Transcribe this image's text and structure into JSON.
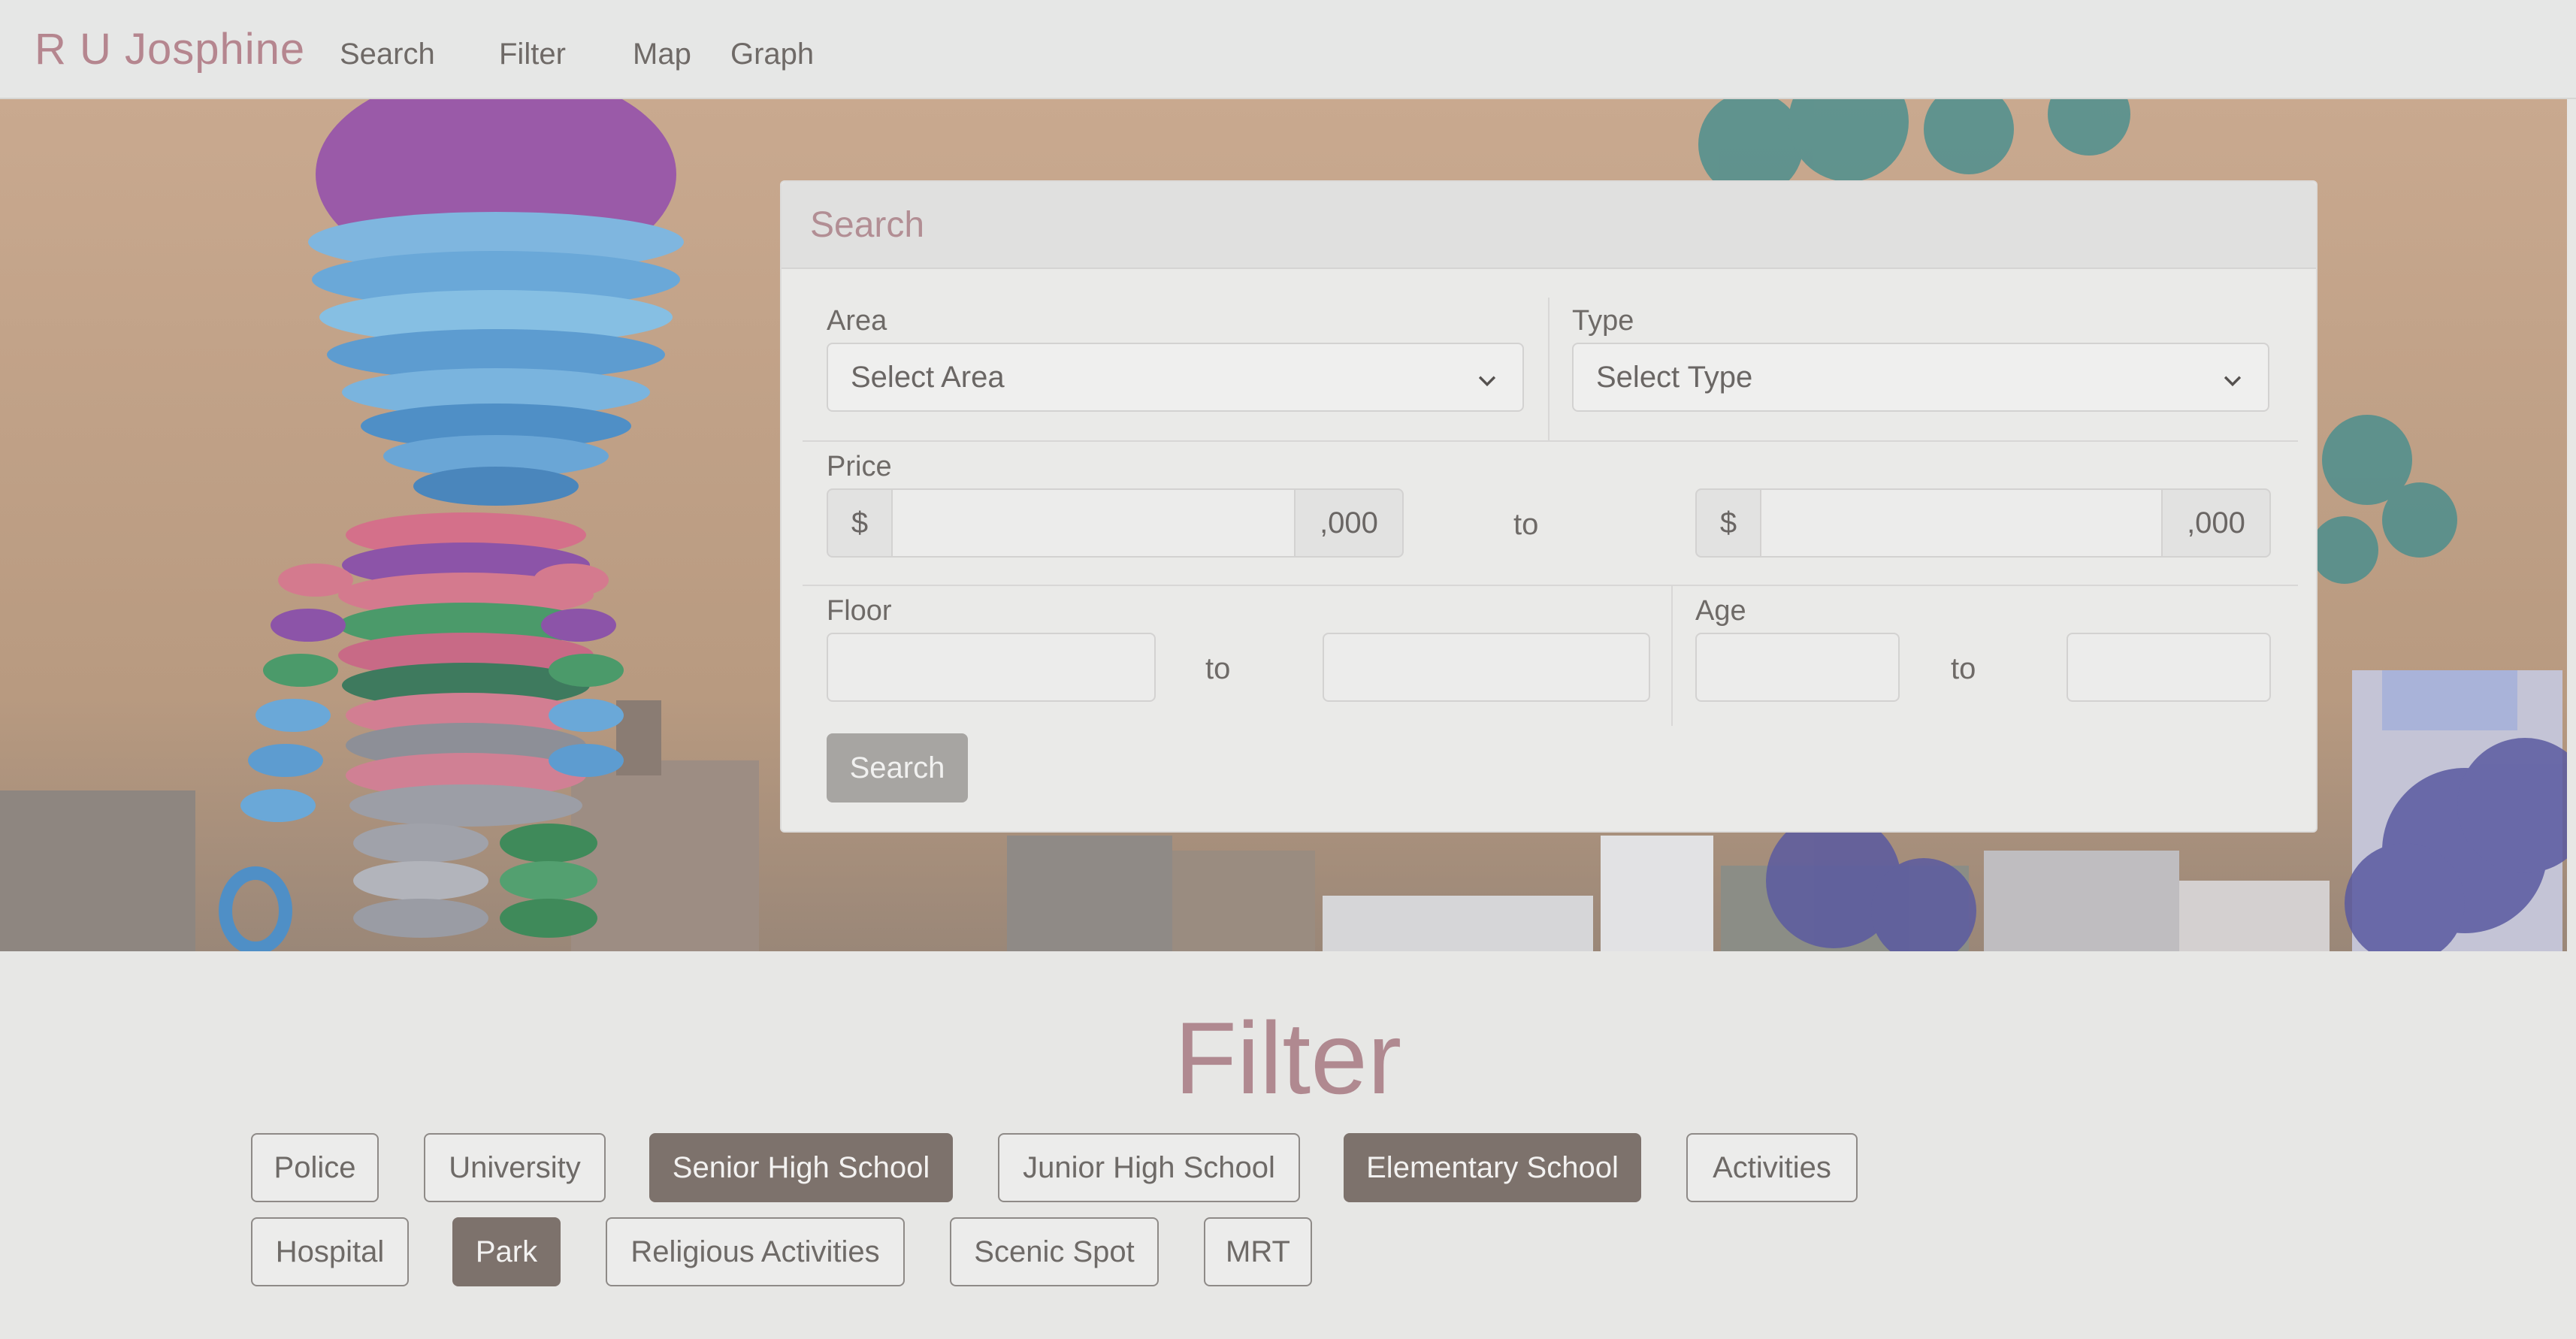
{
  "navbar": {
    "brand": "R U Josphine",
    "links": [
      "Search",
      "Filter",
      "Map",
      "Graph"
    ]
  },
  "search_panel": {
    "title": "Search",
    "area": {
      "label": "Area",
      "value": "Select Area"
    },
    "type": {
      "label": "Type",
      "value": "Select Type"
    },
    "price": {
      "label": "Price",
      "prefix": "$",
      "suffix": ",000",
      "to": "to"
    },
    "floor": {
      "label": "Floor",
      "to": "to"
    },
    "age": {
      "label": "Age",
      "to": "to"
    },
    "button": "Search"
  },
  "filter": {
    "title": "Filter",
    "chips": [
      {
        "label": "Police",
        "active": false
      },
      {
        "label": "University",
        "active": false
      },
      {
        "label": "Senior High School",
        "active": true
      },
      {
        "label": "Junior High School",
        "active": false
      },
      {
        "label": "Elementary School",
        "active": true
      },
      {
        "label": "Activities",
        "active": false
      },
      {
        "label": "Hospital",
        "active": false
      },
      {
        "label": "Park",
        "active": true
      },
      {
        "label": "Religious Activities",
        "active": false
      },
      {
        "label": "Scenic Spot",
        "active": false
      },
      {
        "label": "MRT",
        "active": false
      }
    ]
  },
  "colors": {
    "brand": "#b5868f",
    "chip_active": "#7d726c",
    "panel_bg": "#eaeae8"
  }
}
